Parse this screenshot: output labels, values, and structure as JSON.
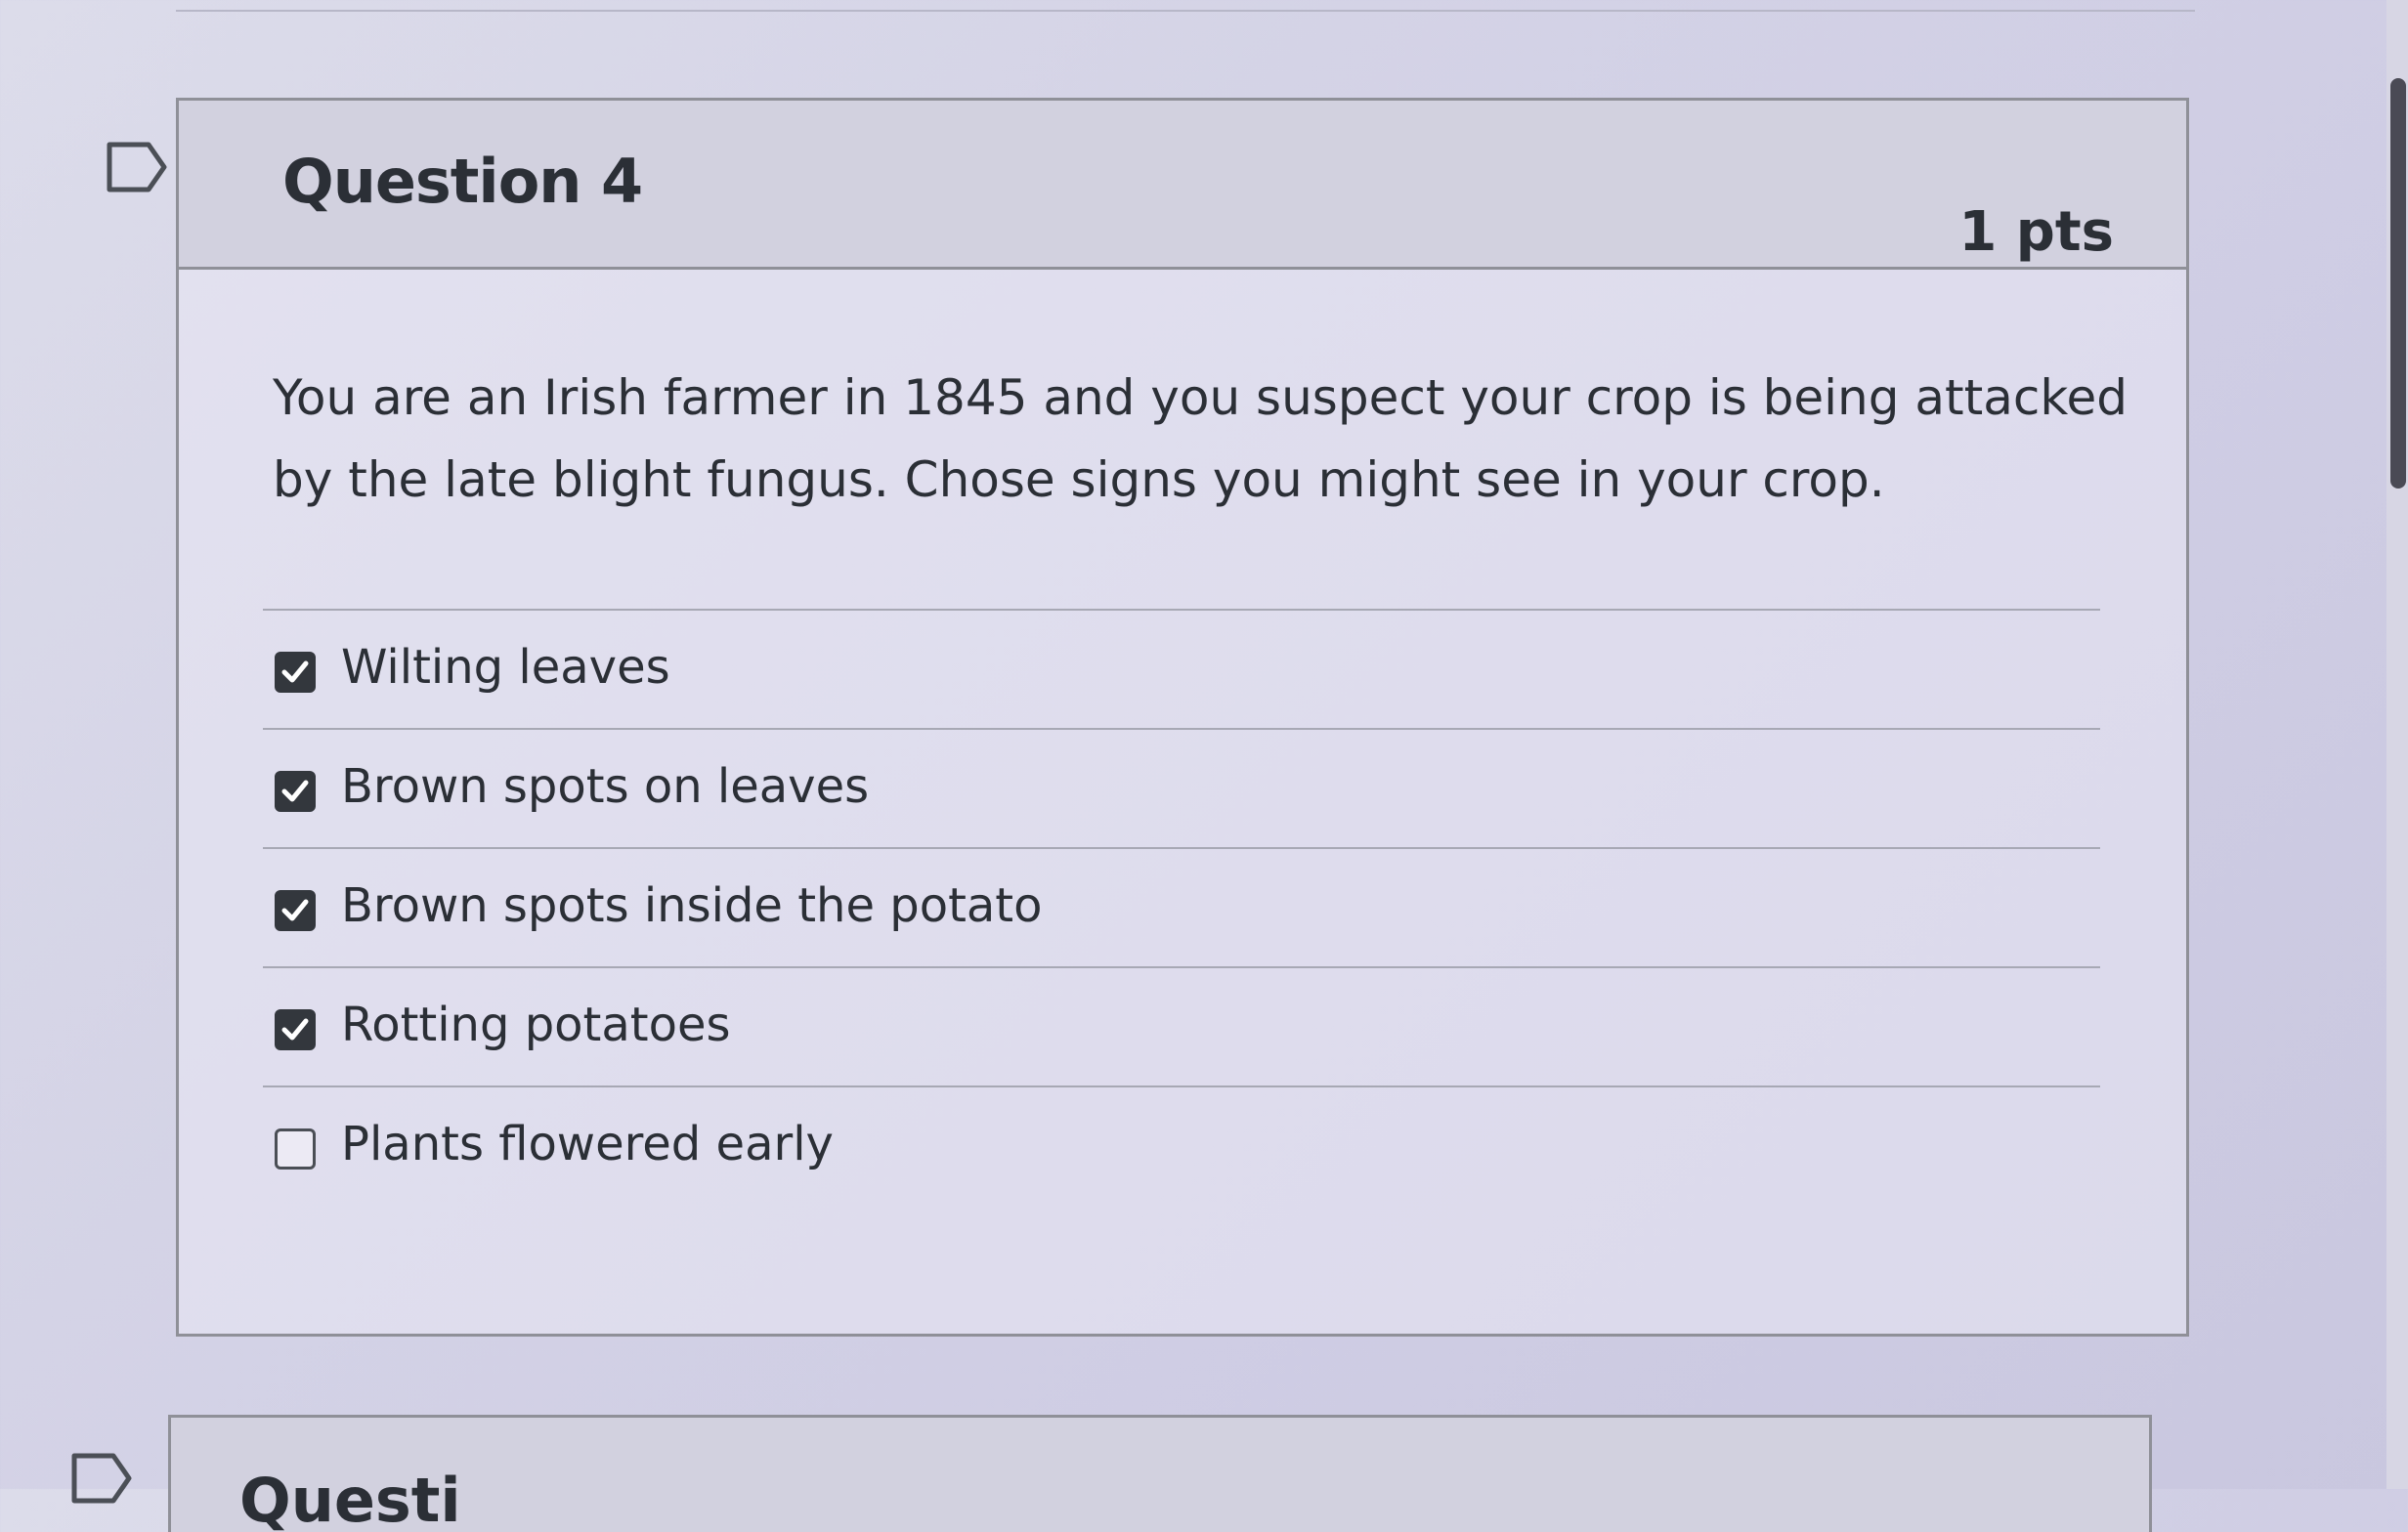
{
  "question": {
    "title": "Question 4",
    "points": "1 pts",
    "text": "You are an Irish farmer in 1845 and you suspect your crop is being attacked by the late blight fungus. Chose signs you might see in your crop.",
    "answers": [
      {
        "label": "Wilting leaves",
        "checked": true
      },
      {
        "label": "Brown spots on leaves",
        "checked": true
      },
      {
        "label": "Brown spots inside the potato",
        "checked": true
      },
      {
        "label": "Rotting potatoes",
        "checked": true
      },
      {
        "label": "Plants flowered early",
        "checked": false
      }
    ]
  },
  "next_question": {
    "title": "Questi"
  },
  "icons": {
    "flag": "flag-icon",
    "checkmark": "checkmark-icon"
  },
  "colors": {
    "checkbox_checked": "#33373d",
    "header_bg": "#d2d1df"
  }
}
